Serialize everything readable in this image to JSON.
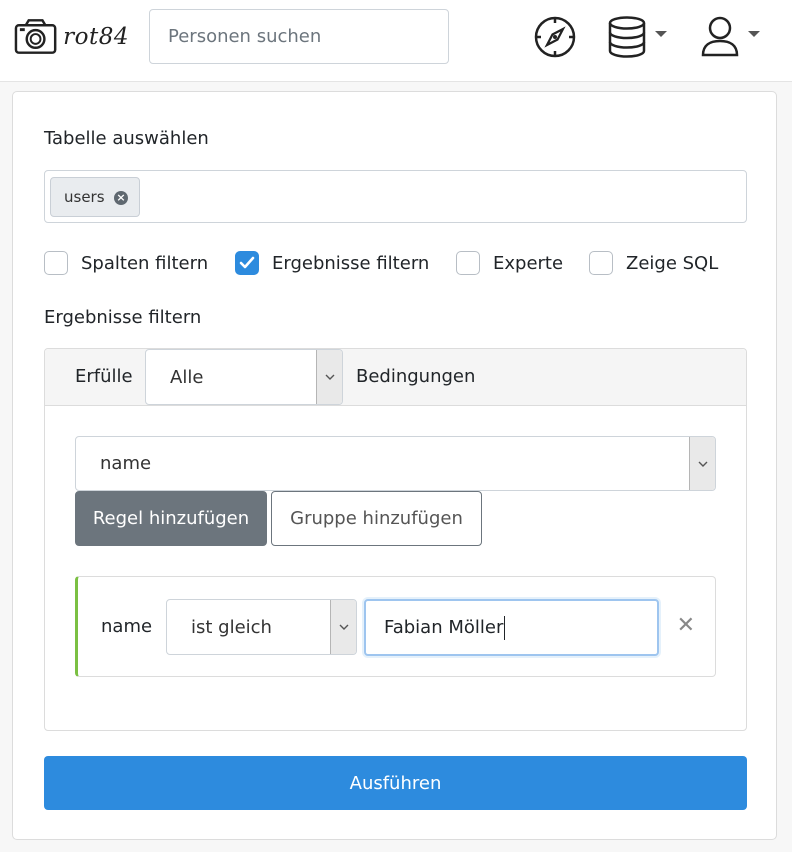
{
  "navbar": {
    "brand_name": "rot84",
    "search_placeholder": "Personen suchen",
    "icons": [
      "camera-icon",
      "compass-icon",
      "database-icon",
      "user-icon"
    ]
  },
  "form": {
    "table_label": "Tabelle auswählen",
    "selected_table": "users",
    "options": [
      {
        "label": "Spalten filtern",
        "checked": false
      },
      {
        "label": "Ergebnisse filtern",
        "checked": true
      },
      {
        "label": "Experte",
        "checked": false
      },
      {
        "label": "Zeige SQL",
        "checked": false
      }
    ],
    "filter_section_label": "Ergebnisse filtern"
  },
  "query_builder": {
    "condition_prefix": "Erfülle",
    "condition_value": "Alle",
    "condition_suffix": "Bedingungen",
    "field_select_value": "name",
    "add_rule_label": "Regel hinzufügen",
    "add_group_label": "Gruppe hinzufügen",
    "rule": {
      "field": "name",
      "operator": "ist gleich",
      "value": "Fabian Möller"
    }
  },
  "run_button_label": "Ausführen",
  "colors": {
    "primary": "#2d8bde",
    "secondary": "#6c757d",
    "rule_accent": "#7bc043"
  }
}
